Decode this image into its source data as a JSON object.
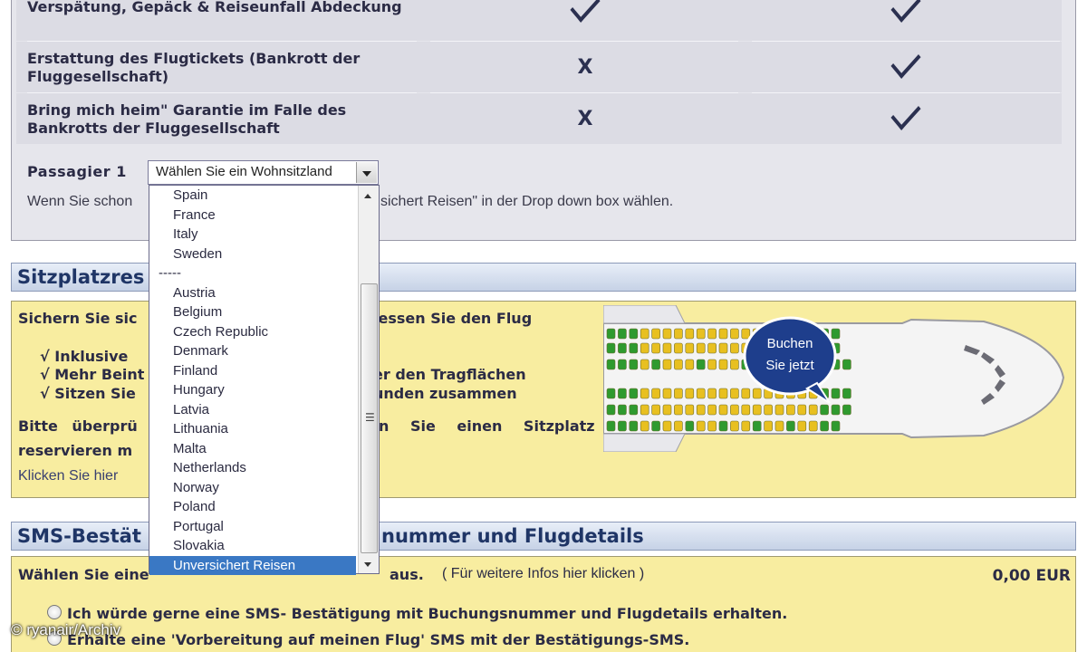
{
  "insurance": {
    "rows": [
      {
        "label": "Verspätung, Gepäck & Reiseunfall Abdeckung",
        "col1": "check",
        "col2": "check"
      },
      {
        "label": "Erstattung des Flugtickets (Bankrott der Fluggesellschaft)",
        "col1": "x",
        "col2": "check"
      },
      {
        "label": "Bring mich heim\" Garantie im Falle des Bankrotts der Fluggesellschaft",
        "col1": "x",
        "col2": "check"
      }
    ],
    "x_glyph": "X",
    "passenger_label": "Passagier 1",
    "select_value": "Wählen Sie ein Wohnsitzland",
    "hint_left": "Wenn Sie schon",
    "hint_right": "sichert Reisen\" in der Drop down box wählen."
  },
  "dropdown": {
    "options": [
      "Spain",
      "France",
      "Italy",
      "Sweden",
      "-----",
      "Austria",
      "Belgium",
      "Czech Republic",
      "Denmark",
      "Finland",
      "Hungary",
      "Latvia",
      "Lithuania",
      "Malta",
      "Netherlands",
      "Norway",
      "Poland",
      "Portugal",
      "Slovakia",
      "Unversichert Reisen"
    ],
    "selected": "Unversichert Reisen"
  },
  "seat": {
    "header": "Sitzplatzres",
    "intro_left": "Sichern Sie sic",
    "intro_right": "iessen Sie den Flug",
    "bullets": [
      {
        "left": "√ Inklusive",
        "right": ""
      },
      {
        "left": "√ Mehr Beint",
        "right": "er den Tragflächen"
      },
      {
        "left": "√ Sitzen Sie",
        "right": "unden zusammen"
      }
    ],
    "check_left": "Bitte überprü",
    "check_right": "n Sie einen Sitzplatz",
    "reserve": "reservieren m",
    "click_here": "Klicken Sie hier",
    "bubble_line1": "Buchen",
    "bubble_line2": "Sie jetzt"
  },
  "sms": {
    "header_left": "SMS-Bestät",
    "header_right": "nummer und Flugdetails",
    "choose_left": "Wählen Sie eine",
    "choose_right": "aus.",
    "more_info": "( Für weitere Infos hier klicken )",
    "price": "0,00 EUR",
    "option1": "Ich würde gerne eine SMS- Bestätigung mit Buchungsnummer und Flugdetails erhalten.",
    "option2": "Erhalte eine 'Vorbereitung auf meinen Flug' SMS mit der Bestätigungs-SMS."
  },
  "watermark": "© ryanair/Archiv",
  "colors": {
    "header_blue": "#1f3566",
    "yellow_panel": "#f8eda0",
    "selected_blue": "#3a78c4",
    "seat_green": "#2f9a2f",
    "seat_yellow": "#e8c020",
    "bubble_blue": "#1e3e8c"
  }
}
